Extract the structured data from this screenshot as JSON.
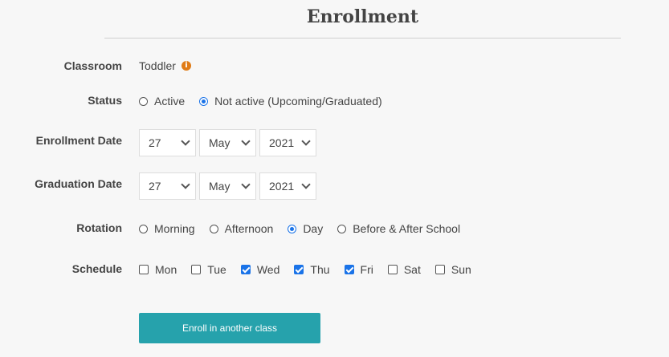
{
  "header": {
    "title": "Enrollment"
  },
  "classroom": {
    "label": "Classroom",
    "value": "Toddler",
    "info_icon": "i"
  },
  "status": {
    "label": "Status",
    "options": [
      {
        "label": "Active",
        "checked": false
      },
      {
        "label": "Not active (Upcoming/Graduated)",
        "checked": true
      }
    ]
  },
  "enrollment_date": {
    "label": "Enrollment Date",
    "day": "27",
    "month": "May",
    "year": "2021"
  },
  "graduation_date": {
    "label": "Graduation Date",
    "day": "27",
    "month": "May",
    "year": "2021"
  },
  "rotation": {
    "label": "Rotation",
    "options": [
      {
        "label": "Morning",
        "checked": false
      },
      {
        "label": "Afternoon",
        "checked": false
      },
      {
        "label": "Day",
        "checked": true
      },
      {
        "label": "Before & After School",
        "checked": false
      }
    ]
  },
  "schedule": {
    "label": "Schedule",
    "days": [
      {
        "label": "Mon",
        "checked": false
      },
      {
        "label": "Tue",
        "checked": false
      },
      {
        "label": "Wed",
        "checked": true
      },
      {
        "label": "Thu",
        "checked": true
      },
      {
        "label": "Fri",
        "checked": true
      },
      {
        "label": "Sat",
        "checked": false
      },
      {
        "label": "Sun",
        "checked": false
      }
    ]
  },
  "actions": {
    "enroll_label": "Enroll in another class"
  },
  "colors": {
    "accent": "#1a73e8",
    "button": "#26a2ac",
    "info": "#e07b16"
  }
}
